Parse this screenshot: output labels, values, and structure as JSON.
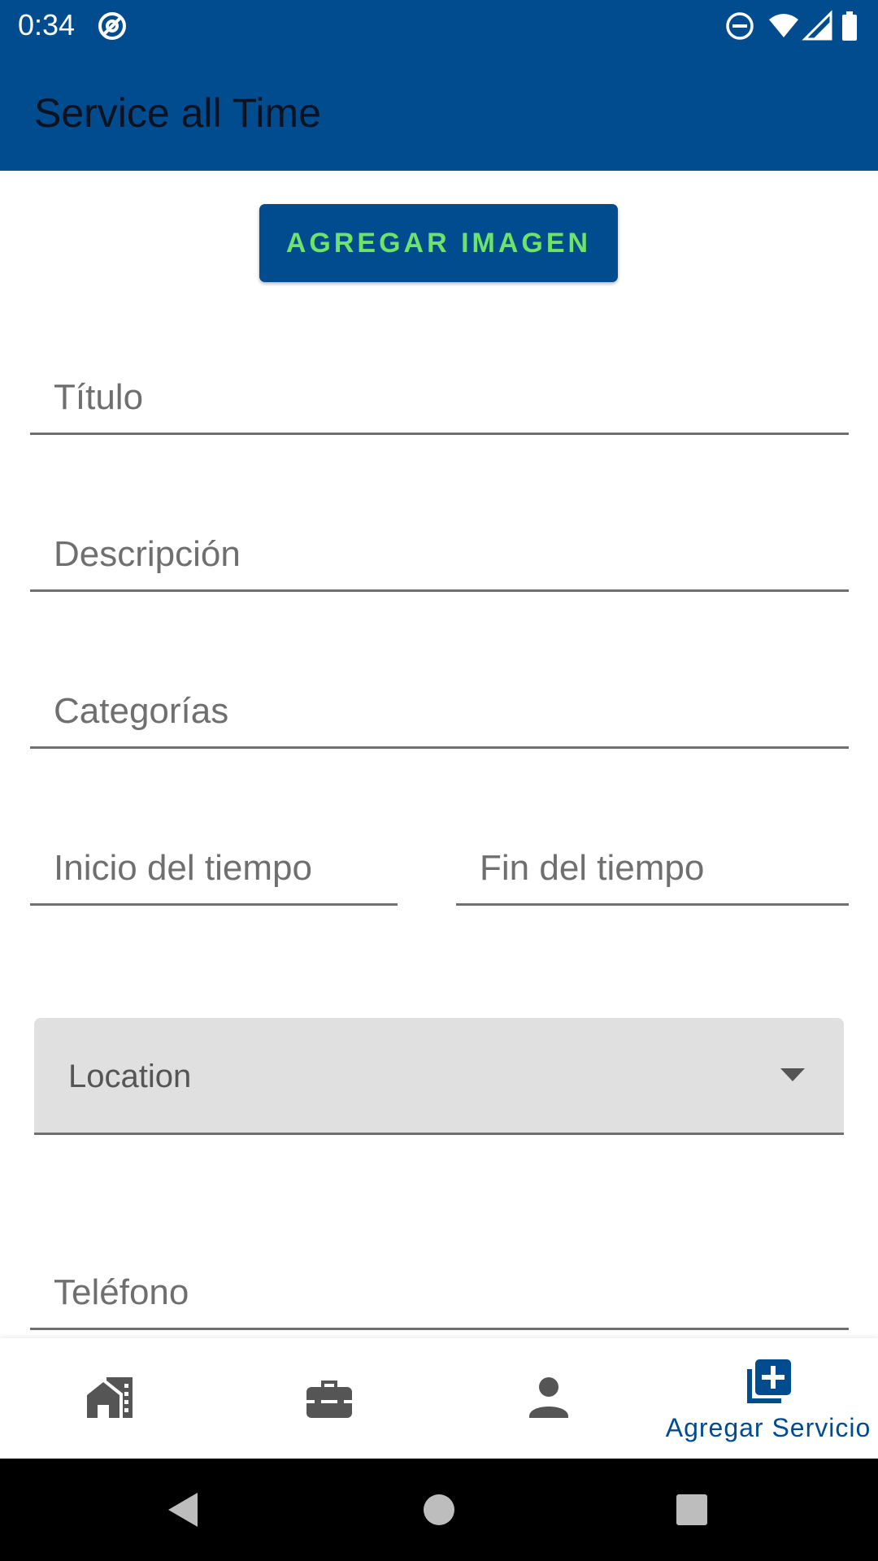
{
  "status_bar": {
    "time": "0:34",
    "icons": [
      "at-sign-icon",
      "do-not-disturb-icon",
      "wifi-icon",
      "signal-icon",
      "battery-icon"
    ]
  },
  "app_bar": {
    "title": "Service all Time"
  },
  "actions": {
    "add_image_label": "AGREGAR IMAGEN"
  },
  "form": {
    "title_placeholder": "Título",
    "description_placeholder": "Descripción",
    "categories_placeholder": "Categorías",
    "start_time_placeholder": "Inicio del tiempo",
    "end_time_placeholder": "Fin del tiempo",
    "location_placeholder": "Location",
    "phone_placeholder": "Teléfono"
  },
  "bottom_nav": {
    "items": [
      {
        "icon": "home-icon",
        "label": ""
      },
      {
        "icon": "briefcase-icon",
        "label": ""
      },
      {
        "icon": "person-icon",
        "label": ""
      },
      {
        "icon": "add-box-icon",
        "label": "Agregar Servicio",
        "active": true
      }
    ]
  },
  "colors": {
    "primary": "#004c8f",
    "accent_text": "#6ee36a",
    "nav_icon": "#555555"
  }
}
